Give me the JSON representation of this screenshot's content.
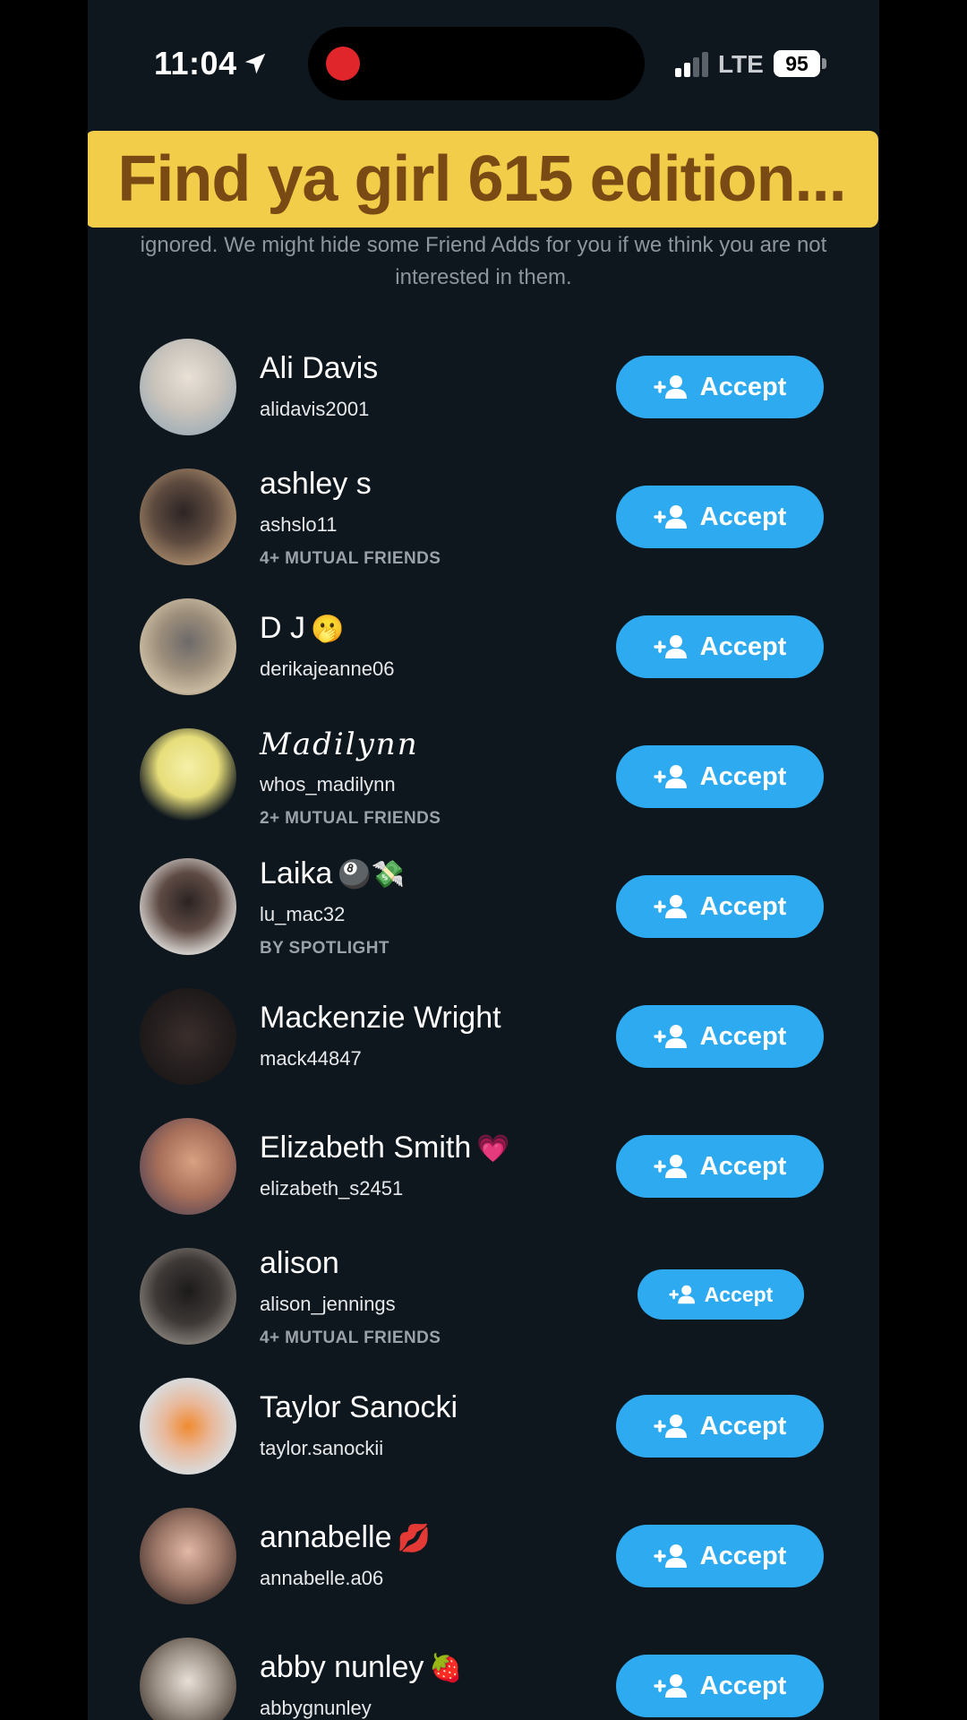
{
  "status_bar": {
    "time": "11:04",
    "network": "LTE",
    "battery": "95"
  },
  "banner": {
    "text": "Find ya girl 615 edition..."
  },
  "info_text": {
    "line1": "ignored. We might hide some Friend Adds for you if we think you are not",
    "line2": "interested in them."
  },
  "accept_label": "Accept",
  "requests": [
    {
      "name": "Ali Davis",
      "emoji": "",
      "username": "alidavis2001",
      "sub": ""
    },
    {
      "name": "ashley s",
      "emoji": "",
      "username": "ashslo11",
      "sub": "4+ MUTUAL FRIENDS"
    },
    {
      "name": "D J",
      "emoji": "🫢",
      "username": "derikajeanne06",
      "sub": ""
    },
    {
      "name": "Madilynn",
      "emoji": "",
      "username": "whos_madilynn",
      "sub": "2+ MUTUAL FRIENDS"
    },
    {
      "name": "Laika",
      "emoji": "🎱💸",
      "username": "lu_mac32",
      "sub": "BY SPOTLIGHT"
    },
    {
      "name": "Mackenzie Wright",
      "emoji": "",
      "username": "mack44847",
      "sub": ""
    },
    {
      "name": "Elizabeth Smith",
      "emoji": "💗",
      "username": "elizabeth_s2451",
      "sub": ""
    },
    {
      "name": "alison",
      "emoji": "",
      "username": "alison_jennings",
      "sub": "4+ MUTUAL FRIENDS"
    },
    {
      "name": "Taylor Sanocki",
      "emoji": "",
      "username": "taylor.sanockii",
      "sub": ""
    },
    {
      "name": "annabelle",
      "emoji": "💋",
      "username": "annabelle.a06",
      "sub": ""
    },
    {
      "name": "abby nunley",
      "emoji": "🍓",
      "username": "abbygnunley",
      "sub": ""
    }
  ],
  "colors": {
    "background": "#0f171e",
    "accept_button": "#2eaaf0",
    "banner": "#f2cd4a",
    "banner_text": "#7a4a14"
  }
}
